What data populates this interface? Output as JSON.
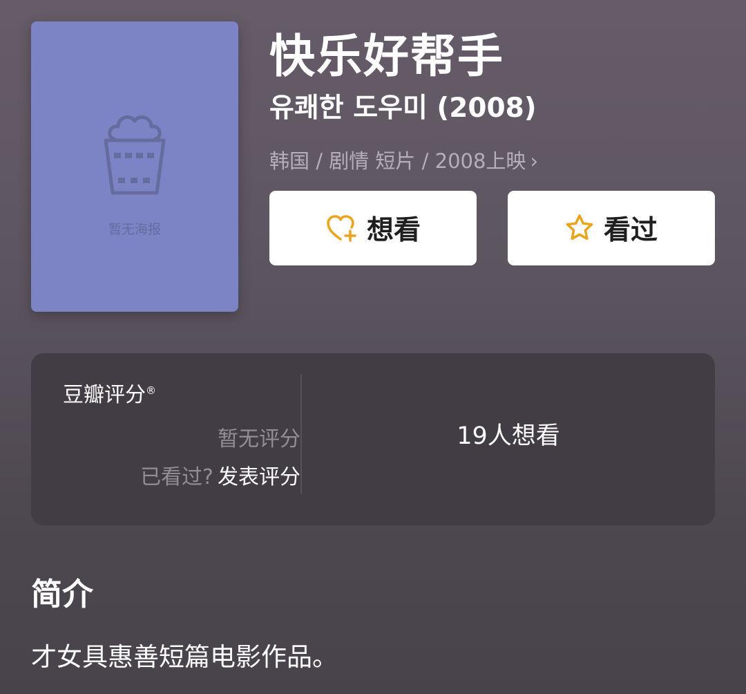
{
  "poster": {
    "icon": "popcorn-bucket-icon",
    "placeholder_text": "暂无海报"
  },
  "movie": {
    "title": "快乐好帮手",
    "original_title": "유쾌한 도우미 (2008)",
    "meta": "韩国 / 剧情 短片 / 2008上映",
    "meta_arrow": "›"
  },
  "actions": {
    "want_label": "想看",
    "want_icon": "heart-plus-icon",
    "seen_label": "看过",
    "seen_icon": "star-outline-icon",
    "icon_color": "#e9a41c"
  },
  "rating": {
    "brand": "豆瓣评分",
    "brand_mark": "®",
    "no_rating": "暂无评分",
    "seen_question": "已看过?",
    "rate_link": "发表评分",
    "want_count": "19人想看"
  },
  "intro": {
    "heading": "简介",
    "text": "才女具惠善短篇电影作品。"
  }
}
